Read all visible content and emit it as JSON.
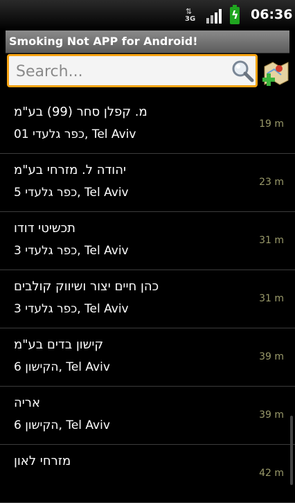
{
  "status": {
    "network": "3G",
    "time": "06:36"
  },
  "app": {
    "title": "Smoking Not APP for Android!"
  },
  "search": {
    "placeholder": "Search..."
  },
  "list": [
    {
      "name": "מ. קפלן סחר (99) בע\"מ",
      "address": "כפר גלעדי 01, Tel Aviv",
      "distance": "19 m"
    },
    {
      "name": "יהודה ל. מזרחי בע\"מ",
      "address": "כפר גלעדי 5, Tel Aviv",
      "distance": "23 m"
    },
    {
      "name": "תכשיטי דודו",
      "address": "כפר גלעדי 3, Tel Aviv",
      "distance": "31 m"
    },
    {
      "name": "כהן חיים יצור ושיווק קולבים",
      "address": "כפר גלעדי 3, Tel Aviv",
      "distance": "31 m"
    },
    {
      "name": "קישון בדים בע\"מ",
      "address": "הקישון 6, Tel Aviv",
      "distance": "39 m"
    },
    {
      "name": "אריה",
      "address": "הקישון 6, Tel Aviv",
      "distance": "39 m"
    },
    {
      "name": "מזרחי לאון",
      "address": "",
      "distance": "42 m"
    }
  ]
}
